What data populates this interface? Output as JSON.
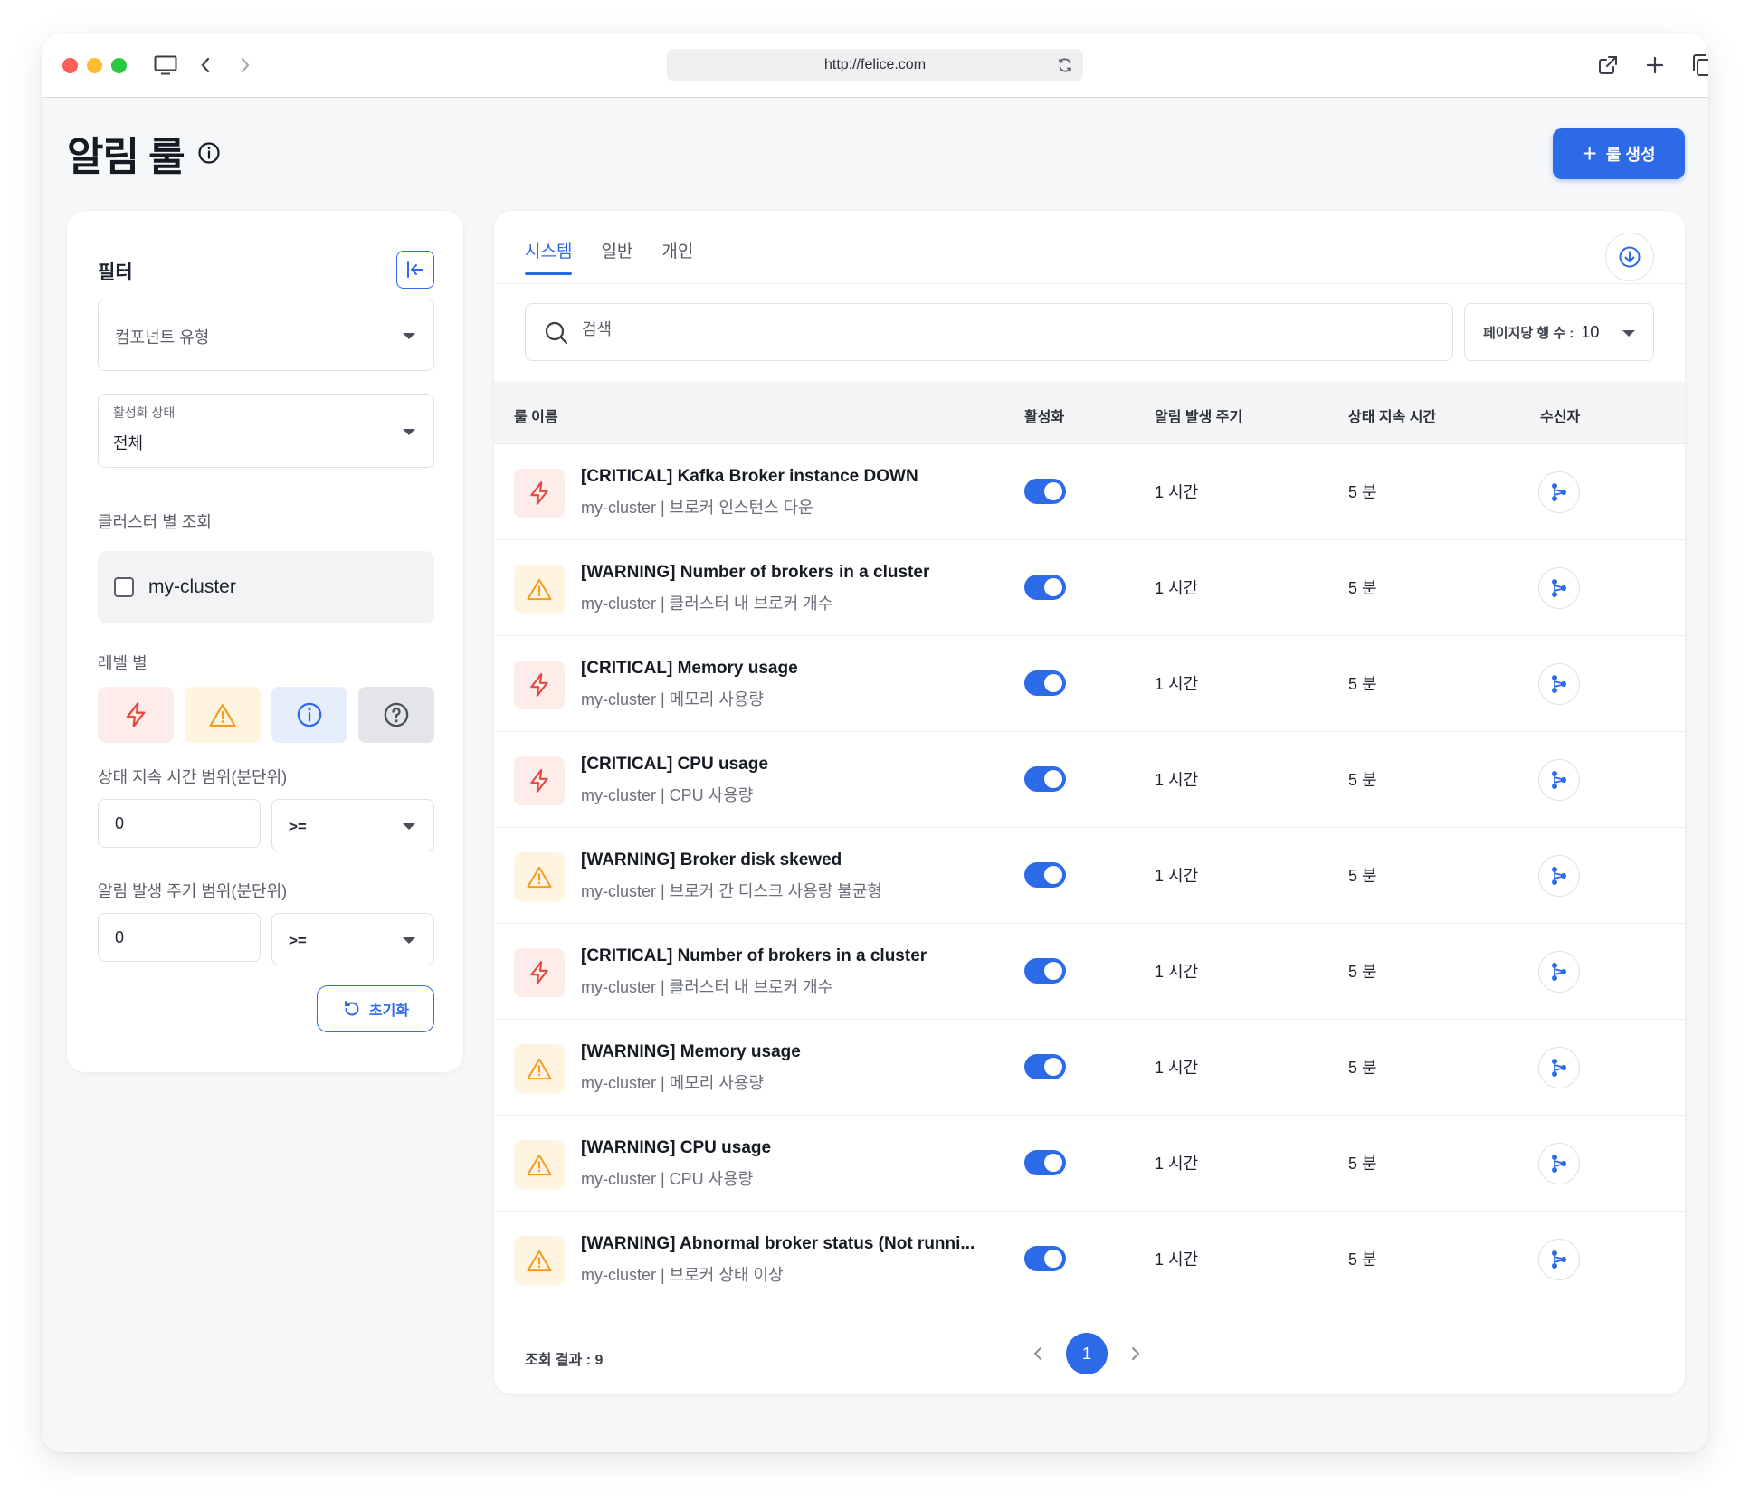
{
  "browser": {
    "url": "http://felice.com"
  },
  "page": {
    "title": "알림 룰",
    "create_button_label": "룰 생성"
  },
  "filter": {
    "title": "필터",
    "component_type_placeholder": "컴포넌트 유형",
    "activation_state_label": "활성화 상태",
    "activation_state_value": "전체",
    "cluster_section_label": "클러스터 별 조회",
    "cluster_option": "my-cluster",
    "level_section_label": "레벨 별",
    "levels": [
      "critical",
      "warning",
      "info",
      "unknown"
    ],
    "duration_label": "상태 지속 시간 범위(분단위)",
    "duration_value": "0",
    "duration_operator": ">=",
    "interval_label": "알림 발생 주기 범위(분단위)",
    "interval_value": "0",
    "interval_operator": ">=",
    "reset_label": "초기화"
  },
  "tabs": [
    {
      "label": "시스템",
      "active": true
    },
    {
      "label": "일반",
      "active": false
    },
    {
      "label": "개인",
      "active": false
    }
  ],
  "search": {
    "placeholder": "검색"
  },
  "rows_per_page": {
    "label": "페이지당 행 수 :",
    "value": "10"
  },
  "table": {
    "headers": {
      "rule_name": "룰 이름",
      "active": "활성화",
      "interval": "알림 발생 주기",
      "duration": "상태 지속 시간",
      "receivers": "수신자"
    },
    "rows": [
      {
        "severity": "critical",
        "title": "[CRITICAL] Kafka Broker instance DOWN",
        "subtitle": "my-cluster | 브로커 인스턴스 다운",
        "active": true,
        "interval": "1 시간",
        "duration": "5 분"
      },
      {
        "severity": "warning",
        "title": "[WARNING] Number of brokers in a cluster",
        "subtitle": "my-cluster | 클러스터 내 브로커 개수",
        "active": true,
        "interval": "1 시간",
        "duration": "5 분"
      },
      {
        "severity": "critical",
        "title": "[CRITICAL] Memory usage",
        "subtitle": "my-cluster | 메모리 사용량",
        "active": true,
        "interval": "1 시간",
        "duration": "5 분"
      },
      {
        "severity": "critical",
        "title": "[CRITICAL] CPU usage",
        "subtitle": "my-cluster | CPU 사용량",
        "active": true,
        "interval": "1 시간",
        "duration": "5 분"
      },
      {
        "severity": "warning",
        "title": "[WARNING] Broker disk skewed",
        "subtitle": "my-cluster | 브로커 간 디스크 사용량 불균형",
        "active": true,
        "interval": "1 시간",
        "duration": "5 분"
      },
      {
        "severity": "critical",
        "title": "[CRITICAL] Number of brokers in a cluster",
        "subtitle": "my-cluster | 클러스터 내 브로커 개수",
        "active": true,
        "interval": "1 시간",
        "duration": "5 분"
      },
      {
        "severity": "warning",
        "title": "[WARNING] Memory usage",
        "subtitle": "my-cluster | 메모리 사용량",
        "active": true,
        "interval": "1 시간",
        "duration": "5 분"
      },
      {
        "severity": "warning",
        "title": "[WARNING] CPU usage",
        "subtitle": "my-cluster | CPU 사용량",
        "active": true,
        "interval": "1 시간",
        "duration": "5 분"
      },
      {
        "severity": "warning",
        "title": "[WARNING] Abnormal broker status (Not runni...",
        "subtitle": "my-cluster | 브로커 상태 이상",
        "active": true,
        "interval": "1 시간",
        "duration": "5 분"
      }
    ]
  },
  "footer": {
    "result_count": "조회 결과 : 9",
    "current_page": "1"
  },
  "colors": {
    "accent": "#2d6ae8",
    "critical": "#e5483f",
    "warning": "#f29d1f",
    "info": "#2d6ae8"
  }
}
